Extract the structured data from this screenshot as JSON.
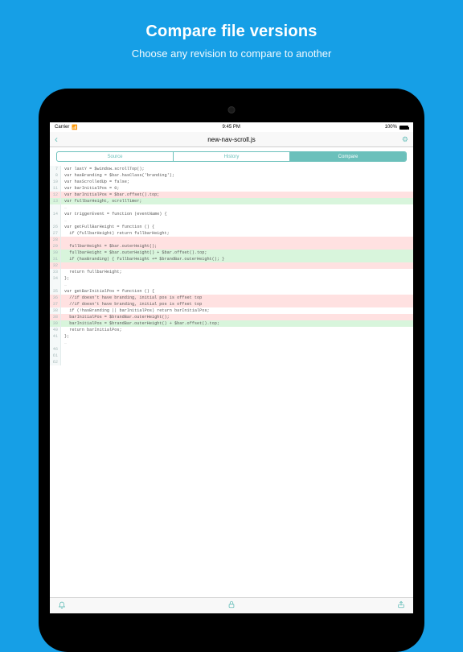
{
  "promo": {
    "title": "Compare file versions",
    "subtitle": "Choose any revision to compare to another"
  },
  "statusbar": {
    "carrier": "Carrier",
    "time": "9:45 PM",
    "battery": "100%"
  },
  "nav": {
    "filename": "new-nav-scroll.js"
  },
  "tabs": {
    "source": "Source",
    "history": "History",
    "compare": "Compare"
  },
  "icons": {
    "back": "‹",
    "gear": "⚙",
    "wifi": "📶",
    "bell": "🔔",
    "lock": "🔒",
    "share": "⇪"
  },
  "diff": [
    {
      "n": 7,
      "k": "",
      "t": "var lastY = $window.scrollTop();"
    },
    {
      "n": 8,
      "k": "",
      "t": "var hasBranding = $bar.hasClass('branding');"
    },
    {
      "n": 10,
      "k": "",
      "t": "var hasScrolledUp = false;"
    },
    {
      "n": 11,
      "k": "",
      "t": "var barInitialPos = 0;"
    },
    {
      "n": 12,
      "k": "del",
      "t": "var barInitialPos = $bar.offset().top;"
    },
    {
      "n": 13,
      "k": "add",
      "t": "var fullbarHeight, scrollTimer;"
    },
    {
      "n": "",
      "k": "sep",
      "t": "…"
    },
    {
      "n": 14,
      "k": "",
      "t": "var triggerEvent = function (eventName) {"
    },
    {
      "n": "",
      "k": "sep",
      "t": "…"
    },
    {
      "n": 26,
      "k": "",
      "t": "var getFullBarHeight = function () {"
    },
    {
      "n": 27,
      "k": "",
      "t": "  if (fullbarHeight) return fullbarHeight;"
    },
    {
      "n": 28,
      "k": "del",
      "t": ""
    },
    {
      "n": 29,
      "k": "del",
      "t": "  fullbarHeight = $bar.outerHeight();"
    },
    {
      "n": 30,
      "k": "add",
      "t": "  fullbarHeight = $bar.outerHeight() + $bar.offset().top;"
    },
    {
      "n": 31,
      "k": "add",
      "t": "  if (hasBranding) { fullbarHeight += $brandBar.outerHeight(); }"
    },
    {
      "n": 32,
      "k": "del",
      "t": ""
    },
    {
      "n": 33,
      "k": "",
      "t": "  return fullbarHeight;"
    },
    {
      "n": 34,
      "k": "",
      "t": "};"
    },
    {
      "n": "",
      "k": "sep",
      "t": "…"
    },
    {
      "n": 35,
      "k": "",
      "t": "var getBarInitialPos = function () {"
    },
    {
      "n": 36,
      "k": "del",
      "t": "  //if doesn't have branding, initial pos is offset top"
    },
    {
      "n": 37,
      "k": "del",
      "t": "  //if doesn't have branding, initial pos is offset top"
    },
    {
      "n": 38,
      "k": "",
      "t": "  if (!hasBranding || barInitialPos) return barInitialPos;"
    },
    {
      "n": 38,
      "k": "del",
      "t": "  barInitialPos = $brandBar.outerHeight();"
    },
    {
      "n": 39,
      "k": "add",
      "t": "  barInitialPos = $brandBar.outerHeight() + $bar.offset().top;"
    },
    {
      "n": 40,
      "k": "",
      "t": "  return barInitialPos;"
    },
    {
      "n": 41,
      "k": "",
      "t": "};"
    },
    {
      "n": "",
      "k": "sep",
      "t": "…"
    },
    {
      "n": 46,
      "k": "",
      "t": ""
    },
    {
      "n": 61,
      "k": "",
      "t": ""
    },
    {
      "n": 62,
      "k": "",
      "t": ""
    }
  ]
}
